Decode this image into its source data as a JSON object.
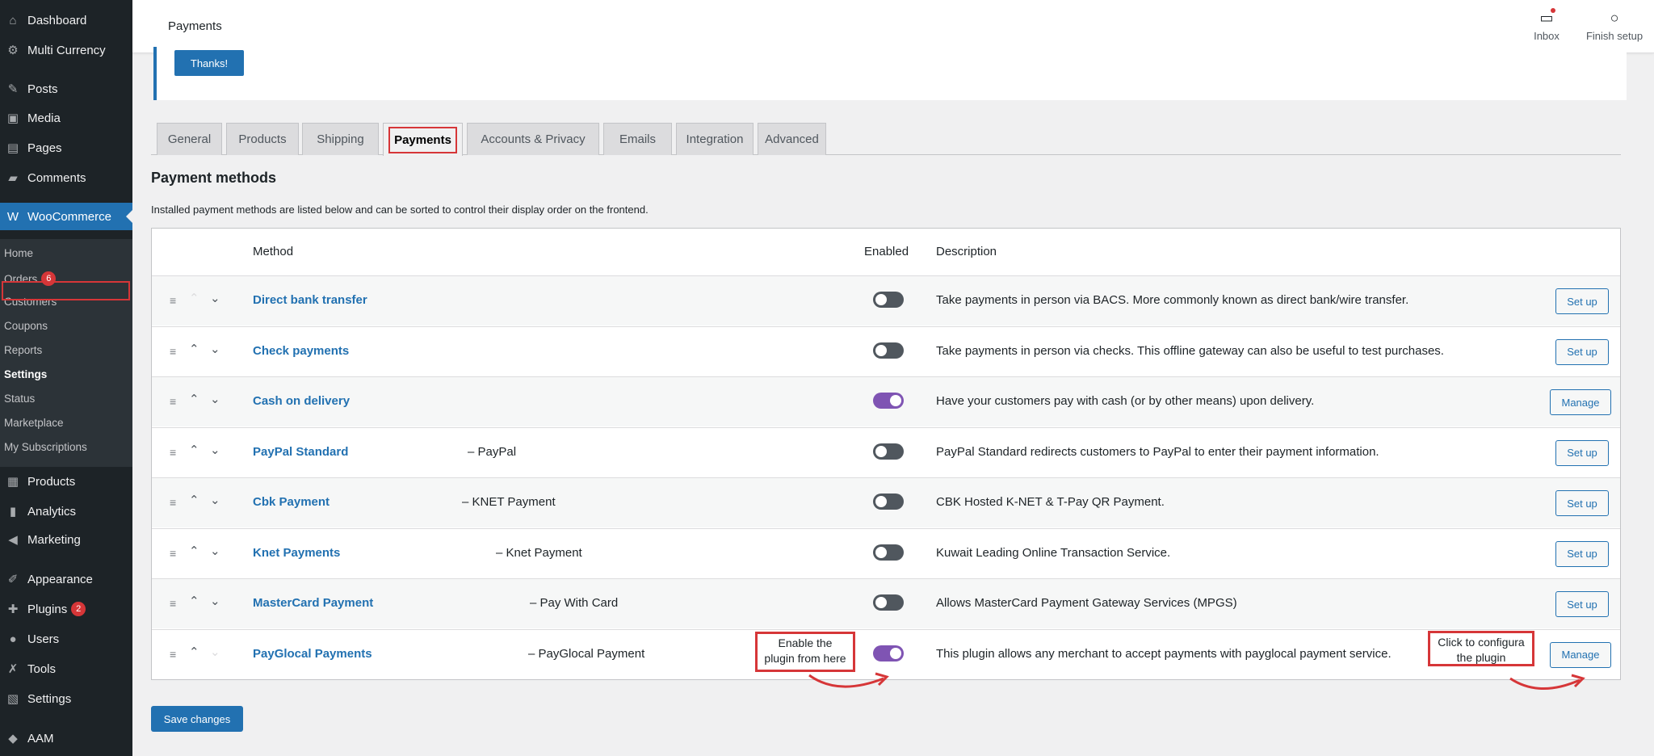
{
  "sidebar": {
    "items": [
      {
        "label": "Dashboard",
        "icon": "dashboard-icon",
        "glyph": "⌂"
      },
      {
        "label": "Multi Currency",
        "icon": "currency-icon",
        "glyph": "⚙"
      },
      {
        "label": "Posts",
        "icon": "pin-icon",
        "glyph": "✎"
      },
      {
        "label": "Media",
        "icon": "media-icon",
        "glyph": "▣"
      },
      {
        "label": "Pages",
        "icon": "pages-icon",
        "glyph": "▤"
      },
      {
        "label": "Comments",
        "icon": "comment-icon",
        "glyph": "▰"
      },
      {
        "label": "WooCommerce",
        "icon": "woo-icon",
        "glyph": "W"
      },
      {
        "label": "Products",
        "icon": "products-icon",
        "glyph": "▦"
      },
      {
        "label": "Analytics",
        "icon": "analytics-icon",
        "glyph": "▮"
      },
      {
        "label": "Marketing",
        "icon": "megaphone-icon",
        "glyph": "◀"
      },
      {
        "label": "Appearance",
        "icon": "brush-icon",
        "glyph": "✐"
      },
      {
        "label": "Plugins",
        "icon": "plug-icon",
        "glyph": "✚",
        "badge": "2"
      },
      {
        "label": "Users",
        "icon": "user-icon",
        "glyph": "●"
      },
      {
        "label": "Tools",
        "icon": "wrench-icon",
        "glyph": "✗"
      },
      {
        "label": "Settings",
        "icon": "settings-icon",
        "glyph": "▧"
      },
      {
        "label": "AAM",
        "icon": "aam-icon",
        "glyph": "◆"
      }
    ],
    "submenu": [
      {
        "label": "Home"
      },
      {
        "label": "Orders",
        "badge": "6"
      },
      {
        "label": "Customers"
      },
      {
        "label": "Coupons"
      },
      {
        "label": "Reports"
      },
      {
        "label": "Settings"
      },
      {
        "label": "Status"
      },
      {
        "label": "Marketplace"
      },
      {
        "label": "My Subscriptions"
      }
    ]
  },
  "topbar": {
    "title": "Payments",
    "inbox_label": "Inbox",
    "finish_label": "Finish setup"
  },
  "notice": {
    "button": "Thanks!"
  },
  "tabs": [
    "General",
    "Products",
    "Shipping",
    "Payments",
    "Accounts & Privacy",
    "Emails",
    "Integration",
    "Advanced"
  ],
  "active_tab": "Payments",
  "section": {
    "title": "Payment methods",
    "description": "Installed payment methods are listed below and can be sorted to control their display order on the frontend."
  },
  "table": {
    "headers": {
      "method": "Method",
      "enabled": "Enabled",
      "description": "Description"
    },
    "rows": [
      {
        "name": "Direct bank transfer",
        "sub": "",
        "enabled": false,
        "description": "Take payments in person via BACS. More commonly known as direct bank/wire transfer.",
        "action": "Set up"
      },
      {
        "name": "Check payments",
        "sub": "",
        "enabled": false,
        "description": "Take payments in person via checks. This offline gateway can also be useful to test purchases.",
        "action": "Set up"
      },
      {
        "name": "Cash on delivery",
        "sub": "",
        "enabled": true,
        "description": "Have your customers pay with cash (or by other means) upon delivery.",
        "action": "Manage"
      },
      {
        "name": "PayPal Standard",
        "sub": "– PayPal",
        "enabled": false,
        "description": "PayPal Standard redirects customers to PayPal to enter their payment information.",
        "action": "Set up"
      },
      {
        "name": "Cbk Payment",
        "sub": "– KNET Payment",
        "enabled": false,
        "description": "CBK Hosted K-NET & T-Pay QR Payment.",
        "action": "Set up"
      },
      {
        "name": "Knet Payments",
        "sub": "– Knet Payment",
        "enabled": false,
        "description": "Kuwait Leading Online Transaction Service.",
        "action": "Set up"
      },
      {
        "name": "MasterCard Payment",
        "sub": "– Pay With Card",
        "enabled": false,
        "description": "Allows MasterCard Payment Gateway Services (MPGS)",
        "action": "Set up"
      },
      {
        "name": "PayGlocal Payments",
        "sub": "– PayGlocal Payment",
        "enabled": true,
        "description": "This plugin allows any merchant to accept payments with payglocal payment service.",
        "action": "Manage"
      }
    ]
  },
  "annotations": {
    "enable": "Enable the plugin from here",
    "configure": "Click to configura the plugin"
  },
  "save_button": "Save changes",
  "colors": {
    "accent": "#2271b1",
    "toggle_on": "#7f54b3",
    "highlight": "#d63638",
    "sidebar": "#1d2327"
  }
}
